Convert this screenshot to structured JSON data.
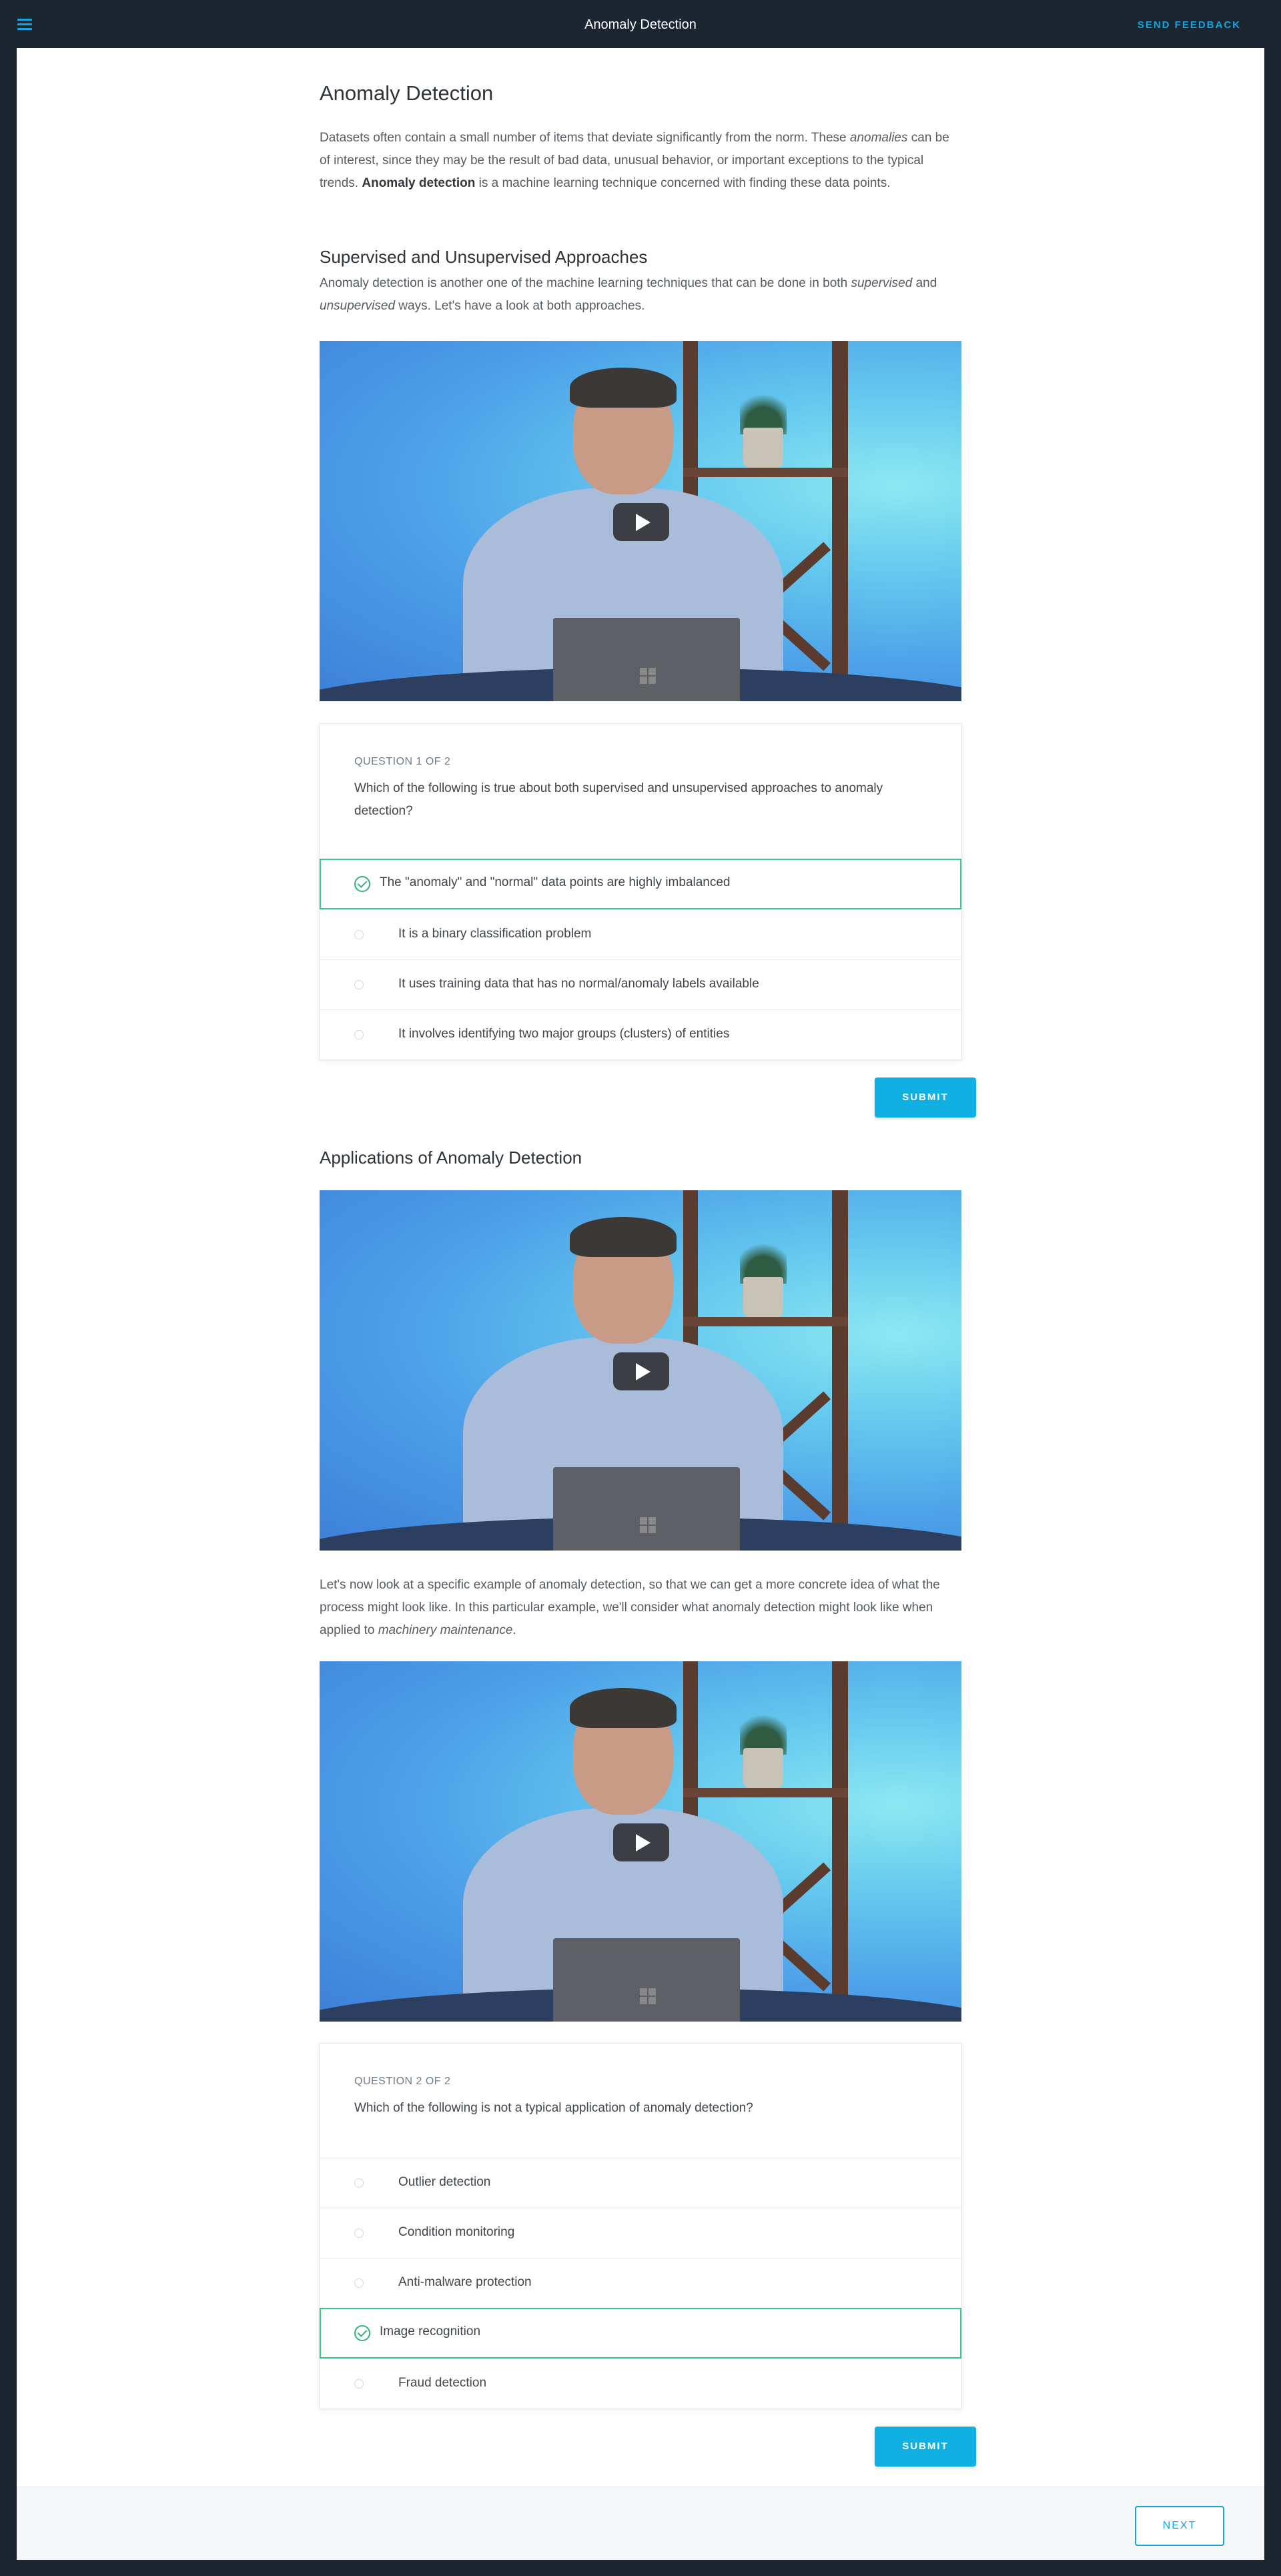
{
  "topbar": {
    "title": "Anomaly Detection",
    "feedback_label": "SEND FEEDBACK"
  },
  "lesson": {
    "title": "Anomaly Detection",
    "intro": {
      "t1": "Datasets often contain a small number of items that deviate significantly from the norm. These ",
      "em1": "anomalies",
      "t2": " can be of interest, since they may be the result of bad data, unusual behavior, or important exceptions to the typical trends. ",
      "b1": "Anomaly detection",
      "t3": " is a machine learning technique concerned with finding these data points."
    },
    "section1": {
      "heading": "Supervised and Unsupervised Approaches",
      "t1": "Anomaly detection is another one of the machine learning techniques that can be done in both ",
      "em1": "supervised",
      "t2": " and ",
      "em2": "unsupervised",
      "t3": " ways. Let's have a look at both approaches."
    },
    "section2": {
      "heading": "Applications of Anomaly Detection",
      "t1": "Let's now look at a specific example of anomaly detection, so that we can get a more concrete idea of what the process might look like. In this particular example, we'll consider what anomaly detection might look like when applied to ",
      "em1": "machinery maintenance",
      "t2": "."
    }
  },
  "quiz1": {
    "number": "QUESTION 1 OF 2",
    "question": "Which of the following is true about both supervised and unsupervised approaches to anomaly detection?",
    "options": [
      "The \"anomaly\" and \"normal\" data points are highly imbalanced",
      "It is a binary classification problem",
      "It uses training data that has no normal/anomaly labels available",
      "It involves identifying two major groups (clusters) of entities"
    ],
    "selected_index": 0,
    "submit_label": "SUBMIT"
  },
  "quiz2": {
    "number": "QUESTION 2 OF 2",
    "question": "Which of the following is not a typical application of anomaly detection?",
    "options": [
      "Outlier detection",
      "Condition monitoring",
      "Anti-malware protection",
      "Image recognition",
      "Fraud detection"
    ],
    "selected_index": 3,
    "submit_label": "SUBMIT"
  },
  "footer": {
    "next_label": "NEXT"
  },
  "colors": {
    "topbar_bg": "#1c2630",
    "accent": "#15a4e0",
    "submit_bg": "#10b0e3",
    "selected_border": "#3cc48d"
  },
  "icons": [
    "menu-icon",
    "play-icon",
    "check-circle-icon",
    "radio-icon"
  ]
}
